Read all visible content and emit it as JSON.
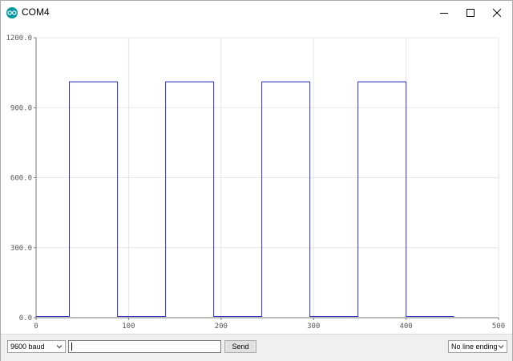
{
  "window": {
    "title": "COM4",
    "icon": "arduino-icon",
    "controls": [
      "minimize-icon",
      "maximize-icon",
      "close-icon"
    ]
  },
  "toolbar": {
    "baud_rate": "9600 baud",
    "input_value": "",
    "send_label": "Send",
    "line_ending": "No line ending"
  },
  "colors": {
    "series": "#3333bb",
    "grid": "#e6e6e6",
    "axis": "#777777"
  },
  "chart_data": {
    "type": "line",
    "title": "",
    "xlabel": "",
    "ylabel": "",
    "xlim": [
      0,
      500
    ],
    "ylim": [
      0,
      1200
    ],
    "xticks": [
      0,
      100,
      200,
      300,
      400,
      500
    ],
    "yticks": [
      0,
      300,
      600,
      900,
      1200
    ],
    "ytick_labels": [
      "0.0",
      "300.0",
      "600.0",
      "900.0",
      "1200.0"
    ],
    "grid": true,
    "legend": "none",
    "series": [
      {
        "x": [
          0,
          36,
          36,
          88,
          88,
          140,
          140,
          192,
          192,
          244,
          244,
          296,
          296,
          348,
          348,
          400,
          400,
          452
        ],
        "y": [
          5,
          5,
          1011,
          1011,
          5,
          5,
          1011,
          1011,
          5,
          5,
          1011,
          1011,
          5,
          5,
          1011,
          1011,
          5,
          5
        ]
      }
    ]
  }
}
